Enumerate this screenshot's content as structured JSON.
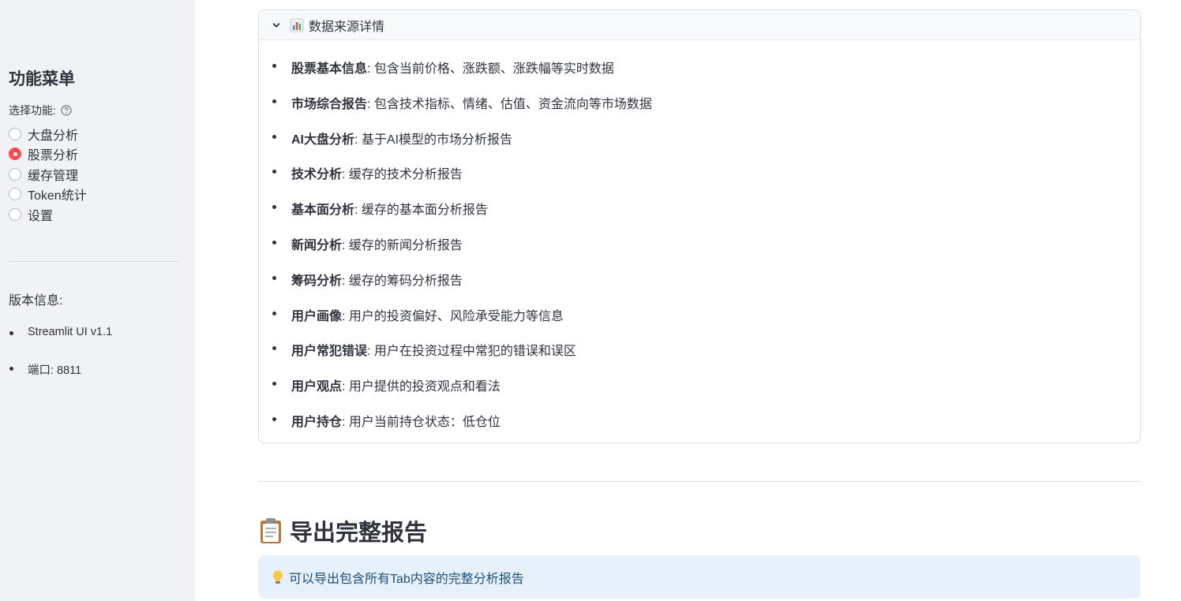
{
  "sidebar": {
    "title": "功能菜单",
    "select_label": "选择功能:",
    "options": [
      {
        "label": "大盘分析",
        "selected": false
      },
      {
        "label": "股票分析",
        "selected": true
      },
      {
        "label": "缓存管理",
        "selected": false
      },
      {
        "label": "Token统计",
        "selected": false
      },
      {
        "label": "设置",
        "selected": false
      }
    ],
    "version_title": "版本信息:",
    "version_items": [
      "Streamlit UI v1.1",
      "端口: 8811"
    ]
  },
  "expander": {
    "title": "数据来源详情",
    "icon": "bar-chart-icon",
    "items": [
      {
        "term": "股票基本信息",
        "desc": ": 包含当前价格、涨跌额、涨跌幅等实时数据"
      },
      {
        "term": "市场综合报告",
        "desc": ": 包含技术指标、情绪、估值、资金流向等市场数据"
      },
      {
        "term": "AI大盘分析",
        "desc": ": 基于AI模型的市场分析报告"
      },
      {
        "term": "技术分析",
        "desc": ": 缓存的技术分析报告"
      },
      {
        "term": "基本面分析",
        "desc": ": 缓存的基本面分析报告"
      },
      {
        "term": "新闻分析",
        "desc": ": 缓存的新闻分析报告"
      },
      {
        "term": "筹码分析",
        "desc": ": 缓存的筹码分析报告"
      },
      {
        "term": "用户画像",
        "desc": ": 用户的投资偏好、风险承受能力等信息"
      },
      {
        "term": "用户常犯错误",
        "desc": ": 用户在投资过程中常犯的错误和误区"
      },
      {
        "term": "用户观点",
        "desc": ": 用户提供的投资观点和看法"
      },
      {
        "term": "用户持仓",
        "desc": ": 用户当前持仓状态：低仓位"
      }
    ]
  },
  "export": {
    "title": "导出完整报告",
    "icon": "clipboard-icon",
    "info_text": "可以导出包含所有Tab内容的完整分析报告",
    "info_icon": "lightbulb-icon"
  },
  "colors": {
    "accent": "#ff4b4b",
    "sidebar_bg": "#f0f2f6",
    "info_bg": "#e6f1fb",
    "info_text": "#1d4f7a"
  }
}
